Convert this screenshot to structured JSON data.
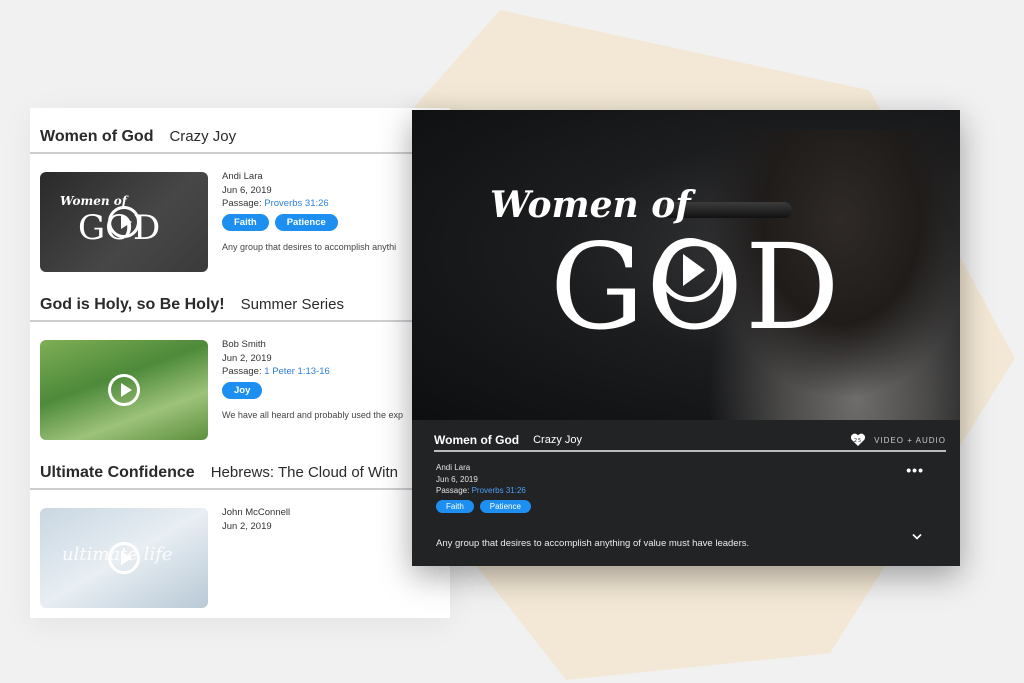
{
  "list": {
    "entries": [
      {
        "title": "Women of God",
        "series": "Crazy Joy",
        "thumb_text_small": "Women of",
        "thumb_text_big": "GOD",
        "speaker": "Andi Lara",
        "date": "Jun 6, 2019",
        "passage_label": "Passage:",
        "passage": "Proverbs 31:26",
        "tags": [
          "Faith",
          "Patience"
        ],
        "description": "Any group that desires to accomplish anythi"
      },
      {
        "title": "God is Holy, so Be Holy!",
        "series": "Summer Series",
        "speaker": "Bob Smith",
        "date": "Jun 2, 2019",
        "passage_label": "Passage:",
        "passage": "1 Peter 1:13-16",
        "tags": [
          "Joy"
        ],
        "description": "We have all heard and probably used the exp"
      },
      {
        "title": "Ultimate Confidence",
        "series": "Hebrews: The Cloud of Witn",
        "thumb_text": "ultimate life",
        "speaker": "John McConnell",
        "date": "Jun 2, 2019"
      }
    ]
  },
  "player": {
    "hero_small": "Women of",
    "hero_big": "GOD",
    "title": "Women of God",
    "series": "Crazy Joy",
    "heart_count": "25",
    "media_type": "VIDEO + AUDIO",
    "speaker": "Andi Lara",
    "date": "Jun 6, 2019",
    "passage_label": "Passage:",
    "passage": "Proverbs 31:26",
    "tags": [
      "Faith",
      "Patience"
    ],
    "more": "•••",
    "description": "Any group that desires to accomplish anything of value must have leaders."
  }
}
